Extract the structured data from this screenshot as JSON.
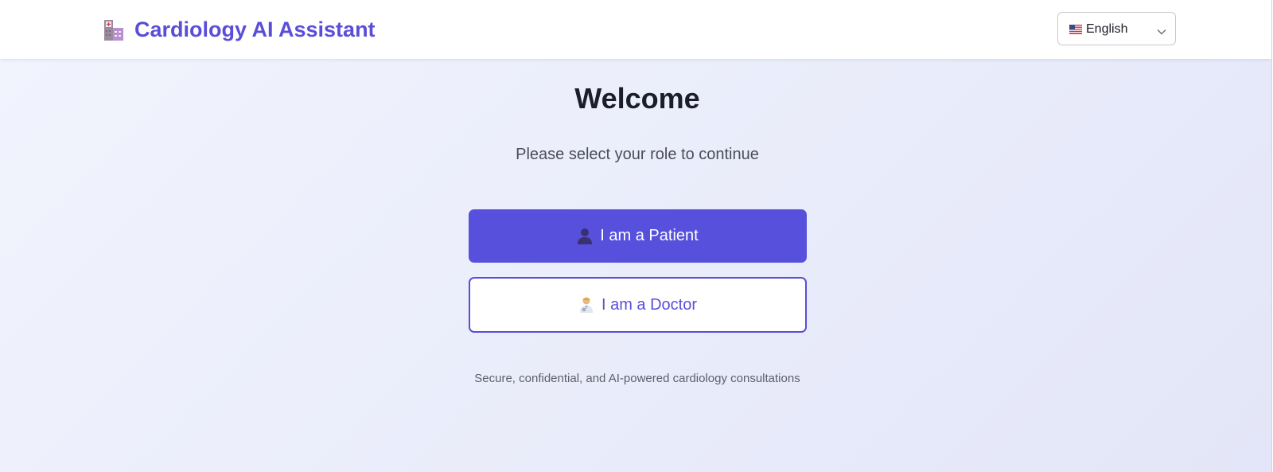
{
  "header": {
    "title": "Cardiology AI Assistant",
    "logo_icon": "hospital-icon",
    "language_select": {
      "selected": "English",
      "flag_icon": "us-flag-icon"
    }
  },
  "main": {
    "heading": "Welcome",
    "subtitle": "Please select your role to continue",
    "roles": [
      {
        "label": "I am a Patient",
        "icon": "patient-silhouette-icon"
      },
      {
        "label": "I am a Doctor",
        "icon": "doctor-icon"
      }
    ],
    "footer_note": "Secure, confidential, and AI-powered cardiology consultations"
  },
  "colors": {
    "accent": "#5a4ed8",
    "primary_button": "#5650dc",
    "heading_text": "#1b1d2b",
    "background_gradient_start": "#f1f3fd",
    "background_gradient_end": "#e3e6f8"
  }
}
